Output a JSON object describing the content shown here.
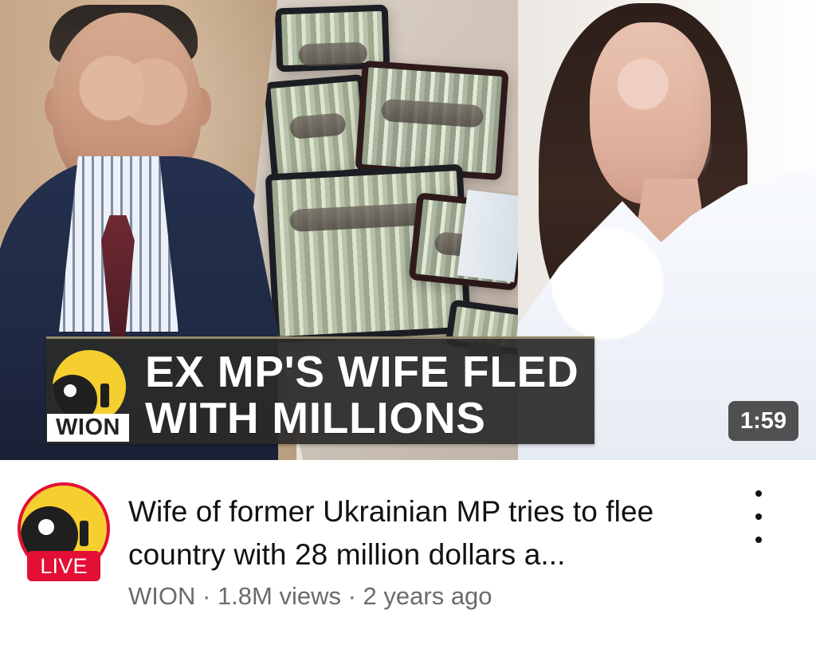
{
  "thumbnail": {
    "headline": "EX MP'S WIFE FLED\nWITH MILLIONS",
    "logo_text": "WION",
    "duration": "1:59",
    "icons": {
      "logo": "wion-logo-icon"
    }
  },
  "video": {
    "title": "Wife of former Ukrainian MP tries to flee country with 28 million dollars a...",
    "channel": "WION",
    "views": "1.8M views",
    "age": "2 years ago",
    "separator": " · ",
    "live_badge": "LIVE",
    "menu_icon": "more-vertical-icon"
  },
  "colors": {
    "accent_red": "#e30f35",
    "logo_yellow": "#f5cf2f",
    "headline_bg": "#2a2a2a"
  }
}
